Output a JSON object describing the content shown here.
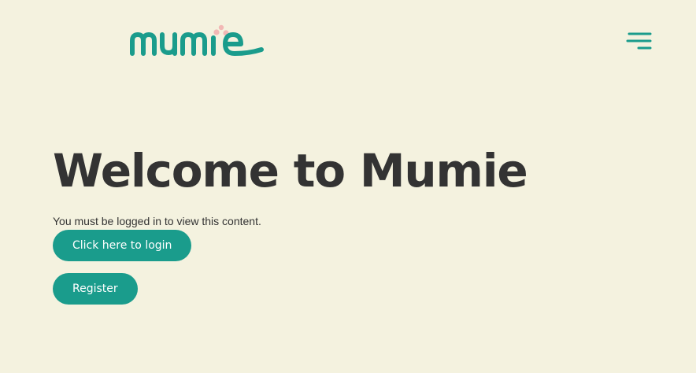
{
  "header": {
    "logo_text": "mumie",
    "menu_icon": "hamburger-menu-icon"
  },
  "main": {
    "title": "Welcome to Mumie",
    "message": "You must be logged in to view this content.",
    "login_label": "Click here to login",
    "register_label": "Register"
  },
  "colors": {
    "background": "#f4f2df",
    "brand": "#1a9c8c",
    "accent_dot": "#f2b8b5",
    "text": "#333333",
    "button_text": "#ffffff"
  }
}
